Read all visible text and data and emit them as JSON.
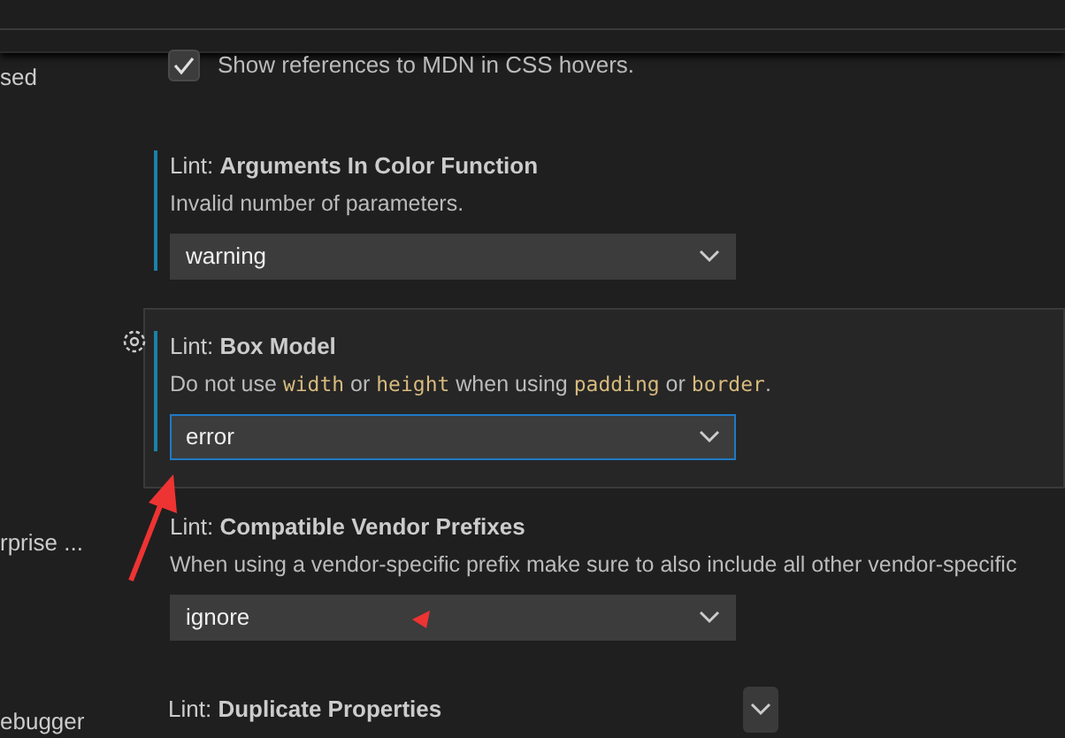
{
  "sidebar": {
    "items": [
      {
        "label": "sed"
      },
      {
        "label": "rprise ..."
      },
      {
        "label": "ebugger"
      }
    ]
  },
  "settings": [
    {
      "kind": "checkbox",
      "description": "Show references to MDN in CSS hovers.",
      "checked": true
    },
    {
      "kind": "dropdown",
      "title": "Lint: **Arguments In Color Function**",
      "description": [
        {
          "text": "Invalid number of parameters.",
          "code": false
        }
      ],
      "value": "warning",
      "modified": true,
      "focused": false
    },
    {
      "kind": "dropdown",
      "title": "Lint: **Box Model**",
      "description": [
        {
          "text": "Do not use ",
          "code": false
        },
        {
          "text": "width",
          "code": true
        },
        {
          "text": " or ",
          "code": false
        },
        {
          "text": "height",
          "code": true
        },
        {
          "text": " when using ",
          "code": false
        },
        {
          "text": "padding",
          "code": true
        },
        {
          "text": " or ",
          "code": false
        },
        {
          "text": "border",
          "code": true
        },
        {
          "text": ".",
          "code": false
        }
      ],
      "value": "error",
      "modified": true,
      "focused": true
    },
    {
      "kind": "dropdown",
      "title": "Lint: **Compatible Vendor Prefixes**",
      "description": [
        {
          "text": "When using a vendor-specific prefix make sure to also include all other vendor-specific",
          "code": false
        }
      ],
      "value": "ignore",
      "modified": false,
      "focused": false
    },
    {
      "kind": "heading",
      "title": "Lint: **Duplicate Properties**"
    }
  ]
}
